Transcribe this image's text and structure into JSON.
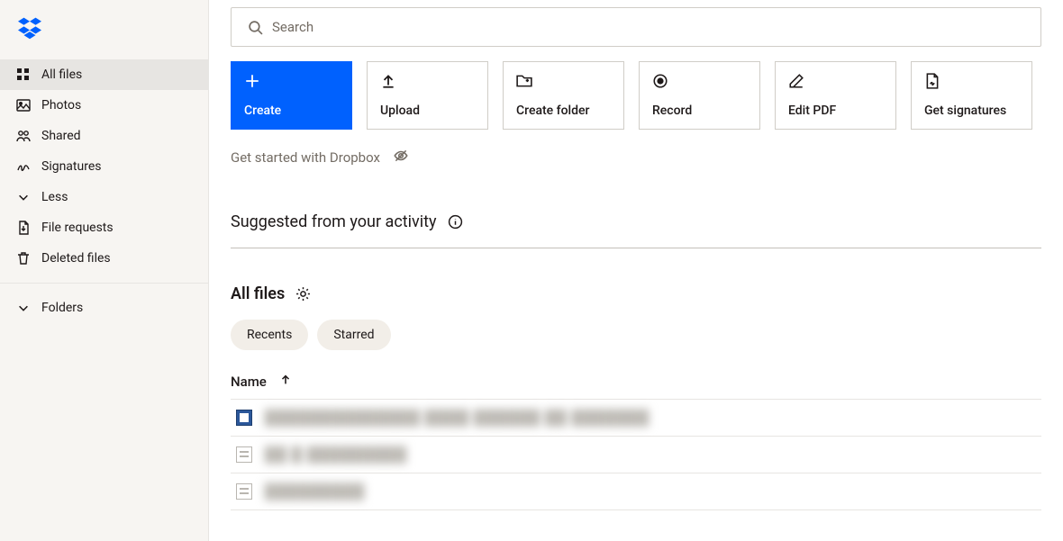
{
  "search": {
    "placeholder": "Search"
  },
  "sidebar": {
    "items": [
      {
        "label": "All files"
      },
      {
        "label": "Photos"
      },
      {
        "label": "Shared"
      },
      {
        "label": "Signatures"
      },
      {
        "label": "Less"
      },
      {
        "label": "File requests"
      },
      {
        "label": "Deleted files"
      }
    ],
    "folders_label": "Folders"
  },
  "actions": [
    {
      "label": "Create"
    },
    {
      "label": "Upload"
    },
    {
      "label": "Create folder"
    },
    {
      "label": "Record"
    },
    {
      "label": "Edit PDF"
    },
    {
      "label": "Get signatures"
    }
  ],
  "get_started": "Get started with Dropbox",
  "suggested_title": "Suggested from your activity",
  "all_files_title": "All files",
  "chips": [
    {
      "label": "Recents"
    },
    {
      "label": "Starred"
    }
  ],
  "col_name": "Name",
  "files": [
    {
      "type": "word",
      "name": "██████████████  ████  ██████   ██ ███████"
    },
    {
      "type": "doc",
      "name": "██ █  █████████"
    },
    {
      "type": "doc",
      "name": "█████████"
    }
  ]
}
